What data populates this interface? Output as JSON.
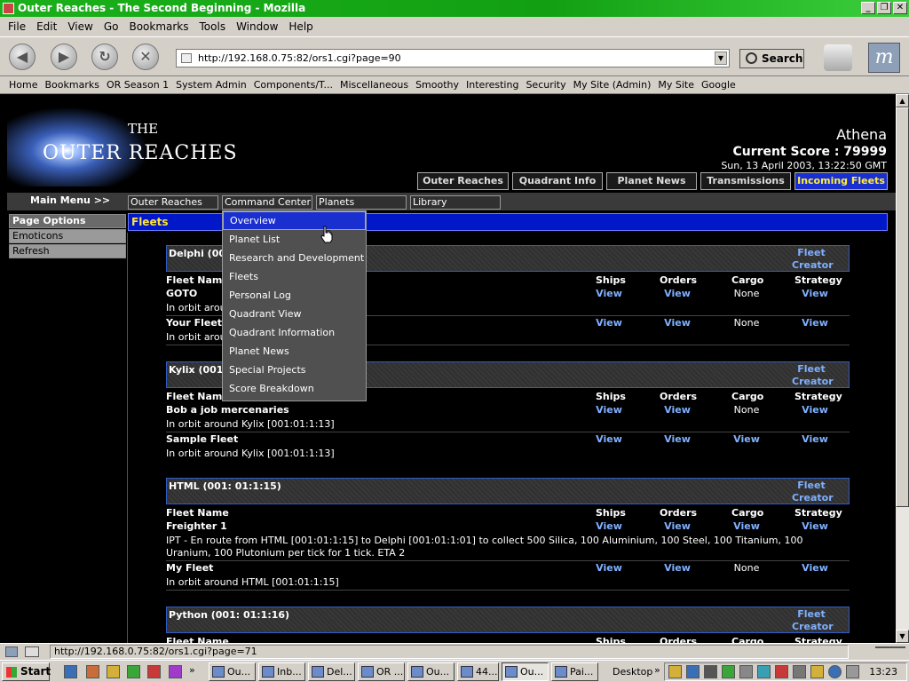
{
  "window": {
    "title": "Outer Reaches - The Second Beginning - Mozilla",
    "buttons": [
      "_",
      "❐",
      "✕"
    ]
  },
  "menubar": [
    "File",
    "Edit",
    "View",
    "Go",
    "Bookmarks",
    "Tools",
    "Window",
    "Help"
  ],
  "navbar": {
    "url": "http://192.168.0.75:82/ors1.cgi?page=90",
    "search_label": "Search"
  },
  "personal_toolbar": [
    "Home",
    "Bookmarks",
    "OR Season 1",
    "System Admin",
    "Components/T...",
    "Miscellaneous",
    "Smoothy",
    "Interesting",
    "Security",
    "My Site (Admin)",
    "My Site",
    "Google"
  ],
  "site": {
    "logo_the": "THE",
    "logo_name": "OUTER REACHES",
    "username": "Athena",
    "score": "Current Score : 79999",
    "datetime": "Sun, 13 April 2003, 13:22:50 GMT",
    "tabs": [
      "Outer Reaches",
      "Quadrant Info",
      "Planet News",
      "Transmissions",
      "Incoming Fleets"
    ],
    "main_menu_label": "Main Menu >>",
    "main_menu": [
      "Outer Reaches",
      "Command Center",
      "Planets",
      "Library"
    ],
    "side": {
      "head": "Page Options",
      "items": [
        "Emoticons",
        "Refresh"
      ]
    },
    "section_title": "Fleets",
    "dropdown": [
      "Overview",
      "Planet List",
      "Research and Development",
      "Fleets",
      "Personal Log",
      "Quadrant View",
      "Quadrant Information",
      "Planet News",
      "Special Projects",
      "Score Breakdown"
    ],
    "col_headers": {
      "name": "Fleet Name",
      "ships": "Ships",
      "orders": "Orders",
      "cargo": "Cargo",
      "strategy": "Strategy"
    },
    "fleet_creator": "Fleet Creator",
    "view": "View",
    "none": "None",
    "groups": [
      {
        "title": "Delphi (001:",
        "rows": [
          {
            "name": "GOTO",
            "desc": "In orbit around",
            "cargo": "None"
          },
          {
            "name": "Your Fleet",
            "desc": "In orbit around",
            "cargo": "None"
          }
        ]
      },
      {
        "title": "Kylix (001: 0",
        "rows": [
          {
            "name": "Bob a job mercenaries",
            "desc": "In orbit around Kylix [001:01:1:13]",
            "cargo": "None"
          },
          {
            "name": "Sample Fleet",
            "desc": "In orbit around Kylix [001:01:1:13]",
            "cargo": "View"
          }
        ]
      },
      {
        "title": "HTML (001: 01:1:15)",
        "rows": [
          {
            "name": "Freighter 1",
            "desc": "IPT - En route from HTML [001:01:1:15] to Delphi [001:01:1:01] to collect 500 Silica, 100 Aluminium, 100 Steel, 100 Titanium, 100 Uranium, 100 Plutonium per tick for 1 tick. ETA 2",
            "cargo": "View"
          },
          {
            "name": "My Fleet",
            "desc": "In orbit around HTML [001:01:1:15]",
            "cargo": "None"
          }
        ]
      },
      {
        "title": "Python (001: 01:1:16)",
        "rows": []
      }
    ]
  },
  "statusbar": {
    "url": "http://192.168.0.75:82/ors1.cgi?page=71"
  },
  "taskbar": {
    "start": "Start",
    "tasks": [
      "Ou...",
      "Inb...",
      "Del...",
      "OR ...",
      "Ou...",
      "44...",
      "Ou...",
      "Pai..."
    ],
    "desktop": "Desktop",
    "clock": "13:23"
  }
}
